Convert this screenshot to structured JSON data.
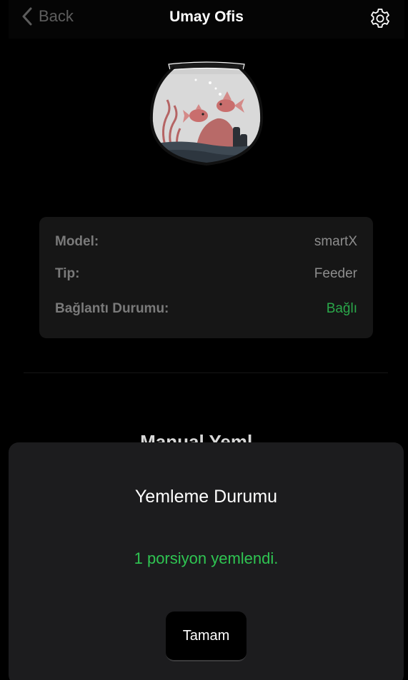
{
  "nav": {
    "back_label": "Back",
    "title": "Umay Ofis",
    "back_icon": "chevron-left-icon",
    "settings_icon": "gear-icon"
  },
  "device_info": {
    "rows": [
      {
        "label": "Model:",
        "value": "smartX"
      },
      {
        "label": "Tip:",
        "value": "Feeder"
      },
      {
        "label": "Bağlantı Durumu:",
        "value": "Bağlı"
      }
    ]
  },
  "section": {
    "partial_heading": "Manual Yeml..."
  },
  "sheet": {
    "title": "Yemleme Durumu",
    "message": "1 porsiyon yemlendi.",
    "ok_label": "Tamam"
  },
  "colors": {
    "background": "#000000",
    "card": "#161616",
    "sheet": "#1c1c1e",
    "connected_green": "#2aa84a",
    "message_green": "#2fc452"
  }
}
